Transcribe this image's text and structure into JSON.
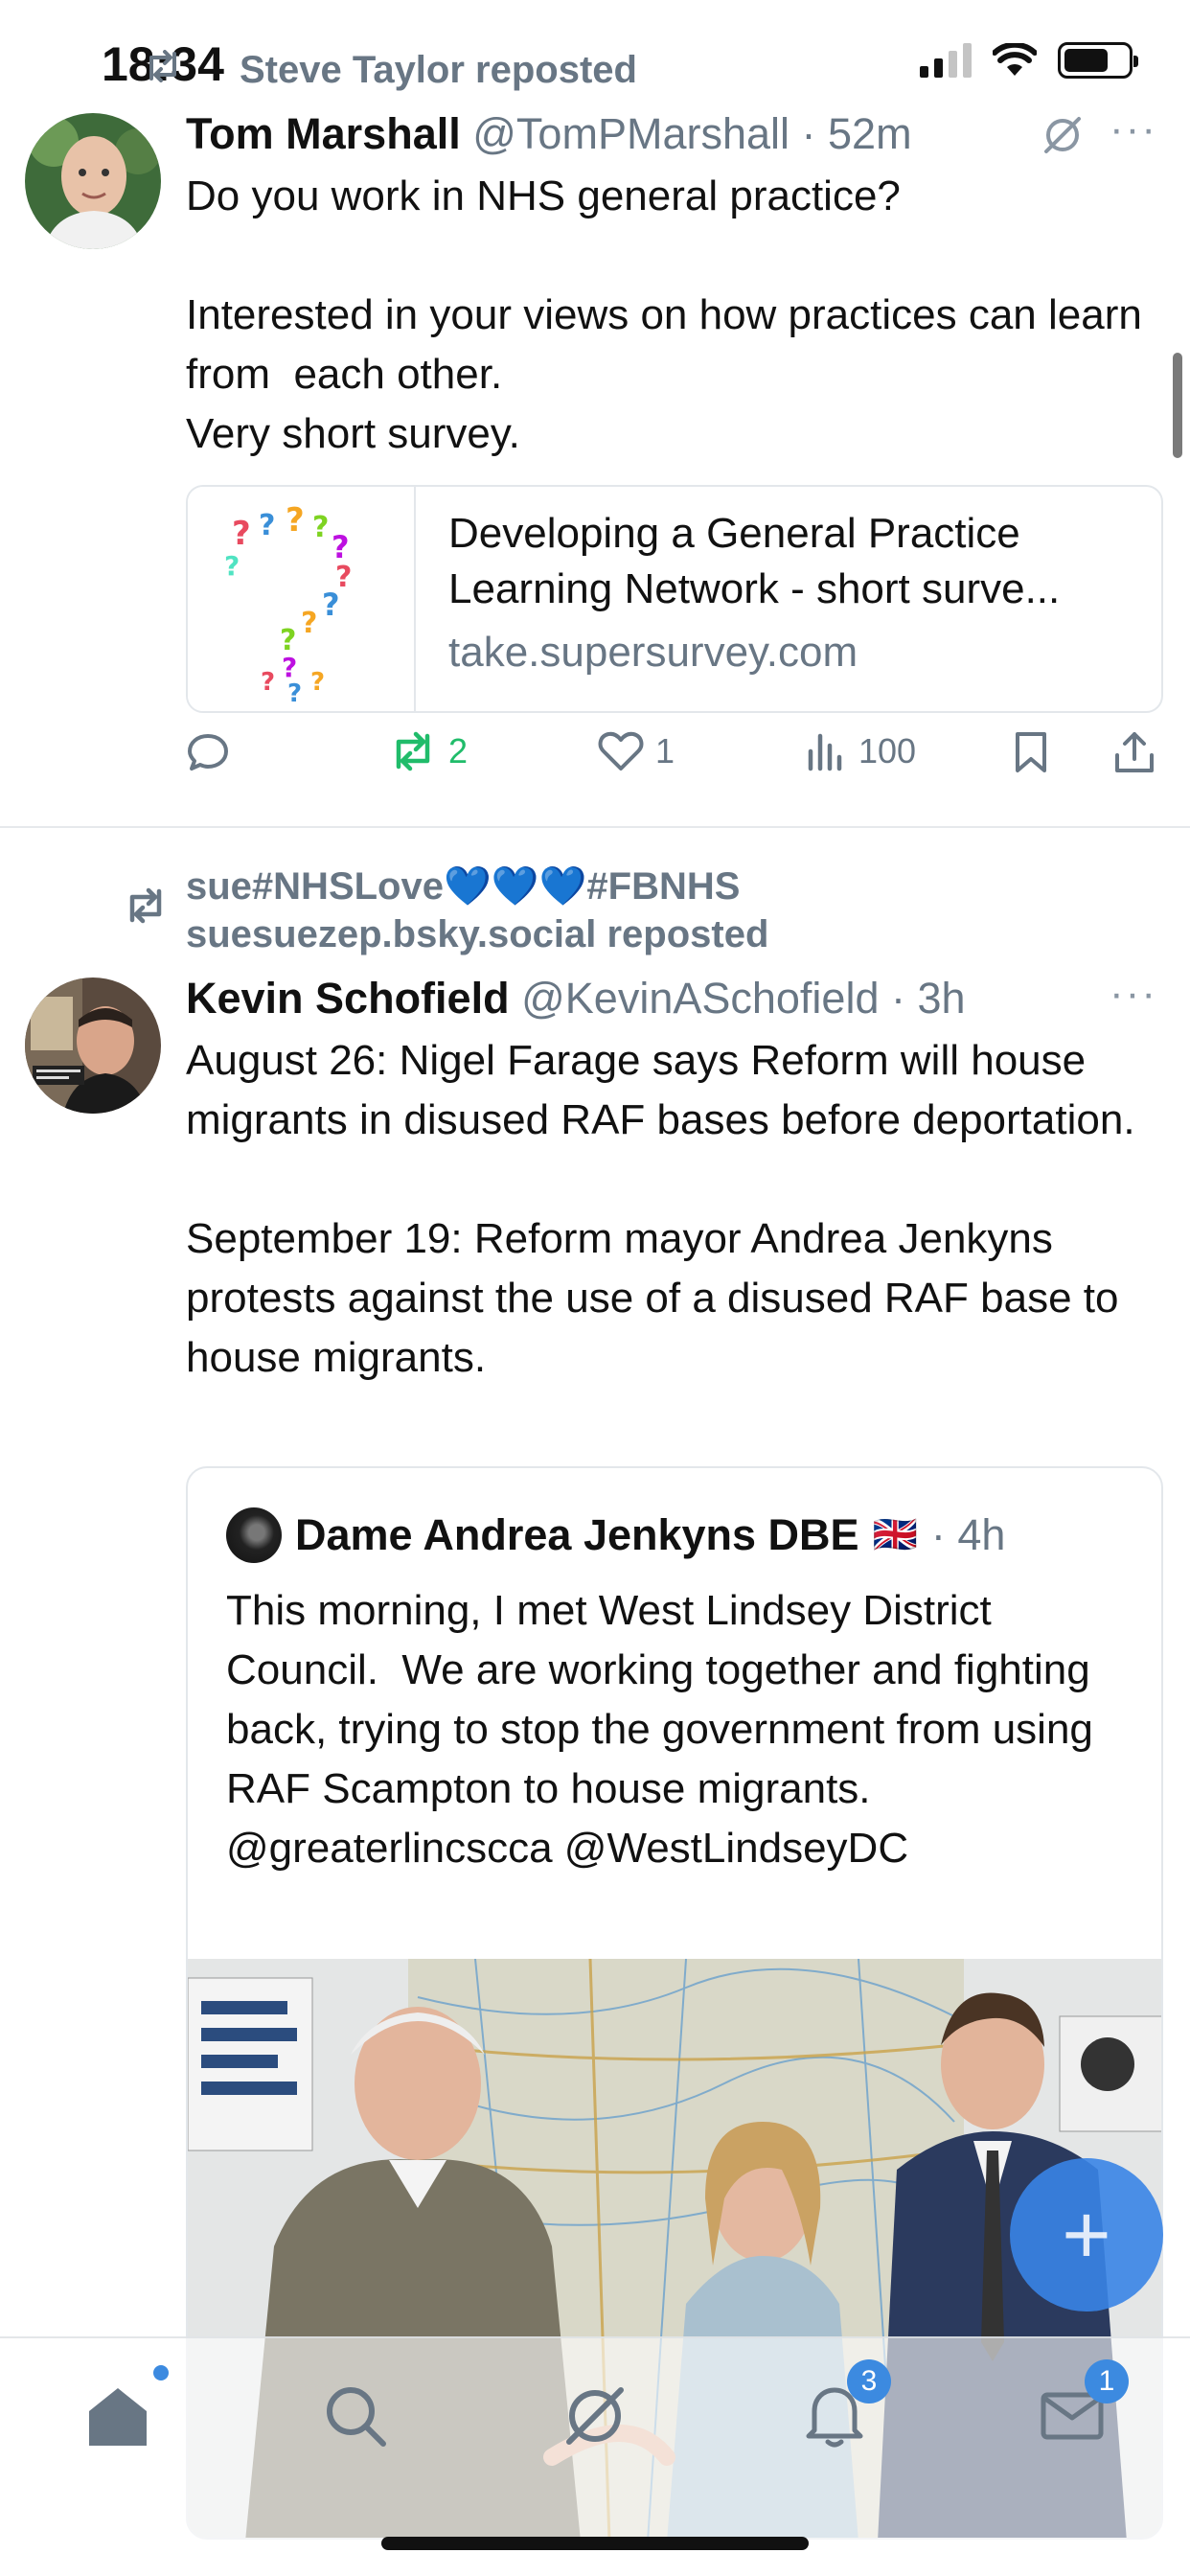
{
  "status_bar": {
    "time": "18:34"
  },
  "feed": {
    "posts": [
      {
        "repost_by": "Steve Taylor reposted",
        "author": "Tom Marshall",
        "handle": "@TomPMarshall",
        "time": "· 52m",
        "text": "Do you work in NHS general practice?\n\nInterested in your views on how practices can learn from  each other.\nVery short survey.",
        "link_card": {
          "title": "Developing a General Practice Learning Network - short surve...",
          "domain": "take.supersurvey.com"
        },
        "stats": {
          "replies": "",
          "reposts": "2",
          "likes": "1",
          "views": "100"
        }
      },
      {
        "repost_by_line1": "sue#NHSLove💙💙💙#FBNHS",
        "repost_by_line2": "suesuezep.bsky.social reposted",
        "author": "Kevin Schofield",
        "handle": "@KevinASchofield",
        "time": "· 3h",
        "text": "August 26: Nigel Farage says Reform will house migrants in disused RAF bases before deportation.\n\nSeptember 19: Reform mayor Andrea Jenkyns protests against the use of a disused RAF base to house migrants.",
        "quote": {
          "author": "Dame Andrea Jenkyns DBE",
          "flag": "🇬🇧",
          "time": "· 4h",
          "text": "This morning, I met West Lindsey District Council.  We are working together and fighting back, trying to stop the government from using RAF Scampton to house migrants. @greaterlincscca @WestLindseyDC"
        }
      }
    ]
  },
  "tabbar": {
    "notifications_badge": "3",
    "messages_badge": "1"
  },
  "colors": {
    "accent": "#3c8ae0",
    "repost_green": "#20bc6a",
    "muted": "#687684"
  },
  "icons": [
    "reply-icon",
    "repost-icon",
    "like-icon",
    "views-icon",
    "bookmark-icon",
    "share-icon",
    "home-icon",
    "search-icon",
    "feeds-icon",
    "bell-icon",
    "mail-icon",
    "compose-icon"
  ]
}
